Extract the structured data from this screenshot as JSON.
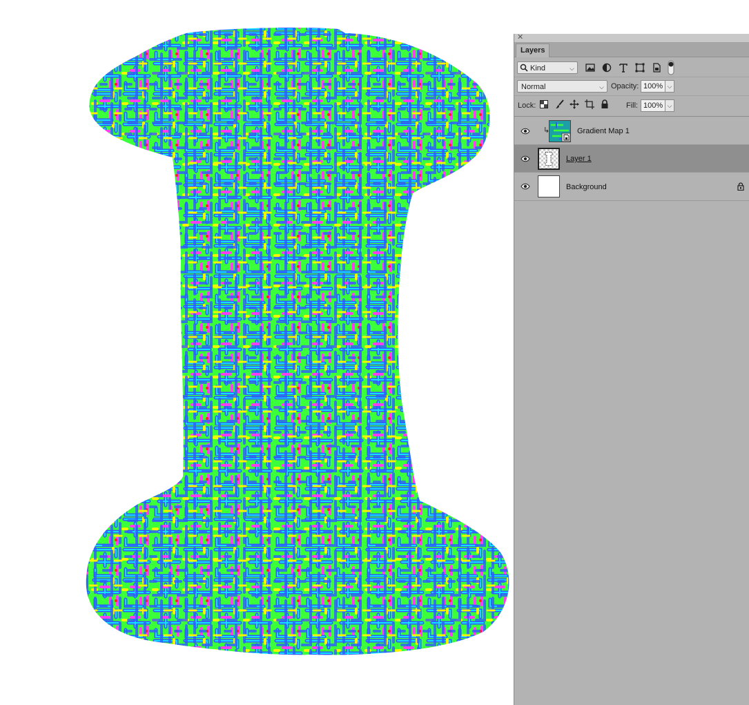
{
  "panel": {
    "tab_label": "Layers",
    "filter": {
      "selected": "Kind"
    },
    "blend_mode": "Normal",
    "opacity_label": "Opacity:",
    "opacity_value": "100%",
    "lock_label": "Lock:",
    "fill_label": "Fill:",
    "fill_value": "100%",
    "layers": [
      {
        "name": "Gradient Map 1",
        "clipped": true,
        "visible": true,
        "selected": false
      },
      {
        "name": "Layer 1",
        "visible": true,
        "selected": true
      },
      {
        "name": "Background",
        "visible": true,
        "selected": false,
        "locked": true
      }
    ]
  },
  "colors": {
    "pattern": [
      "#2d5bff",
      "#12e0ff",
      "#3cff3c",
      "#f5f500",
      "#ff3df0",
      "#ff2020"
    ],
    "panel_bg": "#b3b3b3",
    "selected_row": "#8f8f8f"
  },
  "icons": [
    "search-icon",
    "image-filter-icon",
    "adjustment-filter-icon",
    "type-filter-icon",
    "shape-filter-icon",
    "smart-object-filter-icon",
    "filter-toggle-icon",
    "lock-transparent-icon",
    "lock-paint-icon",
    "lock-move-icon",
    "lock-artboard-icon",
    "lock-all-icon",
    "eye-icon",
    "lock-icon"
  ]
}
